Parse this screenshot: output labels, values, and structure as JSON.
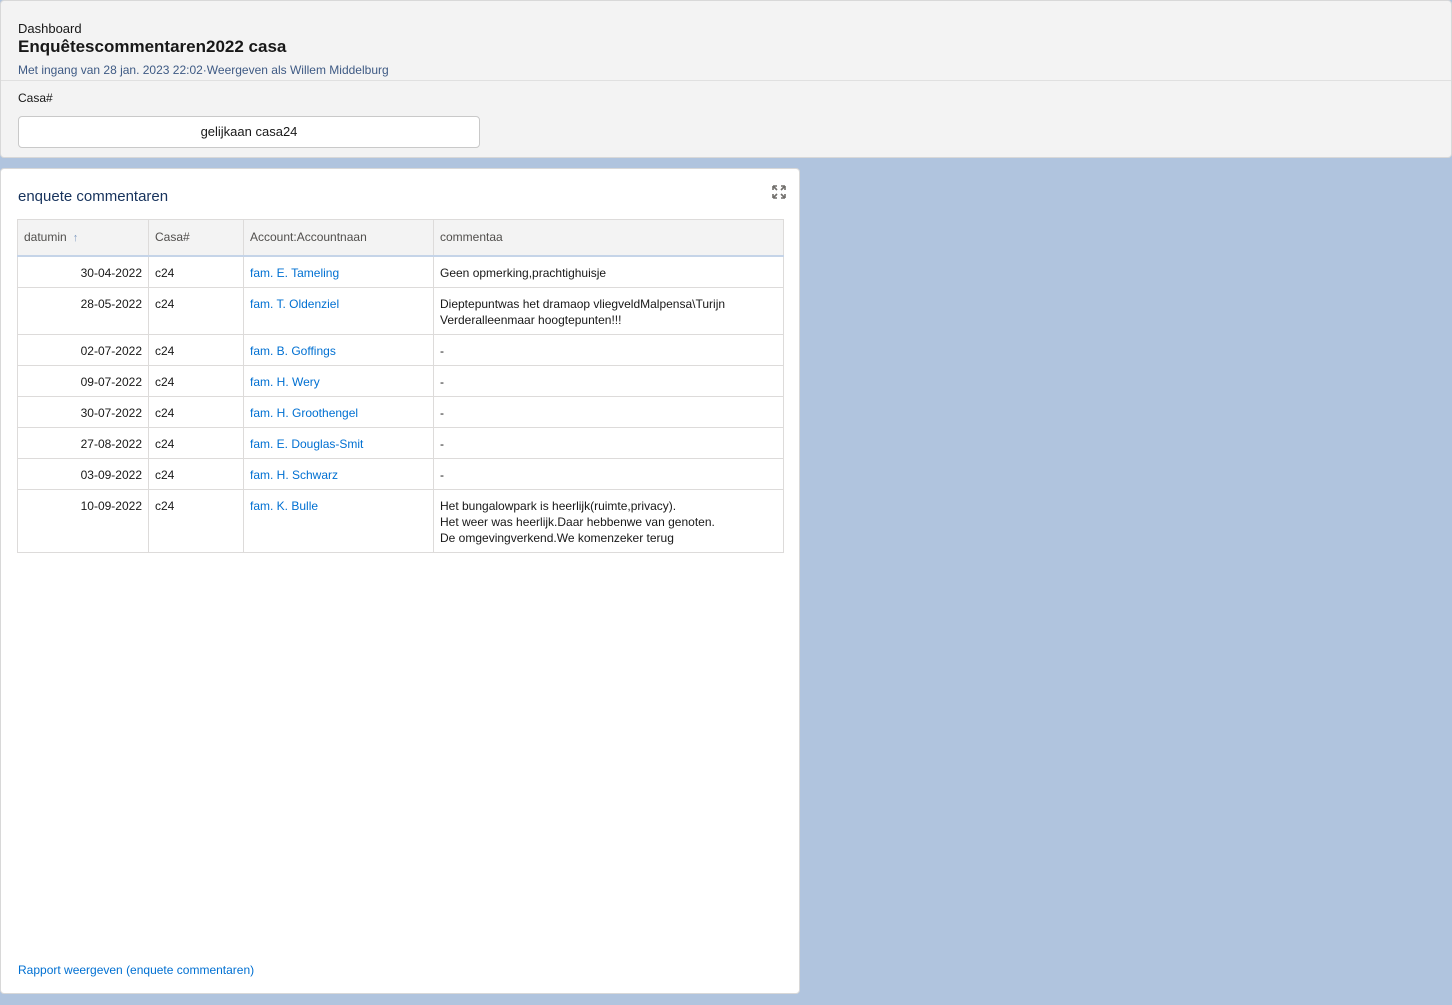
{
  "header": {
    "breadcrumb": "Dashboard",
    "title": "Enquêtescommentaren2022 casa",
    "subtitle": "Met ingang van 28 jan. 2023 22:02·Weergeven als Willem Middelburg",
    "filter": {
      "label": "Casa#",
      "value": "gelijkaan casa24"
    }
  },
  "widget": {
    "title": "enquete commentaren",
    "expand_icon": "expand-icon",
    "columns": [
      "datumin",
      "Casa#",
      "Account:Accountnaan",
      "commentaa"
    ],
    "sort_icon": "↑",
    "rows": [
      {
        "date": "30-04-2022",
        "casa": "c24",
        "account": "fam. E. Tameling",
        "comment": "Geen opmerking,prachtighuisje"
      },
      {
        "date": "28-05-2022",
        "casa": "c24",
        "account": "fam. T. Oldenziel",
        "comment": "Dieptepuntwas het dramaop vliegveldMalpensa\\Turijn\nVerderalleenmaar hoogtepunten!!!"
      },
      {
        "date": "02-07-2022",
        "casa": "c24",
        "account": "fam. B. Goffings",
        "comment": "-"
      },
      {
        "date": "09-07-2022",
        "casa": "c24",
        "account": "fam. H. Wery",
        "comment": "-"
      },
      {
        "date": "30-07-2022",
        "casa": "c24",
        "account": "fam. H. Groothengel",
        "comment": "-"
      },
      {
        "date": "27-08-2022",
        "casa": "c24",
        "account": "fam. E. Douglas-Smit",
        "comment": "-"
      },
      {
        "date": "03-09-2022",
        "casa": "c24",
        "account": "fam. H. Schwarz",
        "comment": "-"
      },
      {
        "date": "10-09-2022",
        "casa": "c24",
        "account": "fam. K. Bulle",
        "comment": "Het bungalowpark is heerlijk(ruimte,privacy).\nHet weer was heerlijk.Daar hebbenwe van genoten.\nDe omgevingverkend.We komenzeker terug"
      }
    ],
    "report_link": "Rapport weergeven (enquete commentaren)"
  }
}
